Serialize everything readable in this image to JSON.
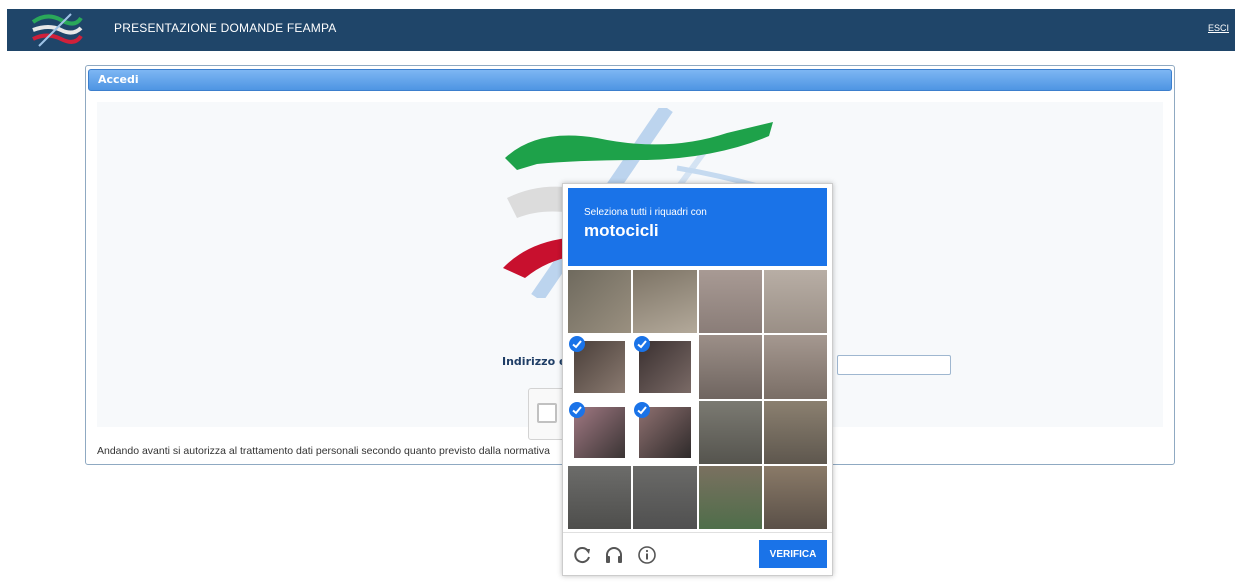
{
  "header": {
    "title": "PRESENTAZIONE DOMANDE FEAMPA",
    "exit_label": "ESCI"
  },
  "panel": {
    "title": "Accedi",
    "email_label": "Indirizzo ema",
    "email_value": "",
    "privacy_text": "Andando avanti si autorizza al trattamento dati personali secondo quanto previsto dalla normativa"
  },
  "recaptcha": {
    "instruction": "Seleziona tutti i riquadri con",
    "target": "motocicli",
    "verify_label": "VERIFICA",
    "tiles": [
      {
        "selected": false
      },
      {
        "selected": false
      },
      {
        "selected": false
      },
      {
        "selected": false
      },
      {
        "selected": true
      },
      {
        "selected": true
      },
      {
        "selected": false
      },
      {
        "selected": false
      },
      {
        "selected": true
      },
      {
        "selected": true
      },
      {
        "selected": false
      },
      {
        "selected": false
      },
      {
        "selected": false
      },
      {
        "selected": false
      },
      {
        "selected": false
      },
      {
        "selected": false
      }
    ],
    "footer_icons": [
      "reload-icon",
      "audio-icon",
      "info-icon"
    ]
  },
  "colors": {
    "header_bg": "#1f4569",
    "panel_header": "#4e95e3",
    "recaptcha_blue": "#1a73e8",
    "flag_green": "#1ea24a",
    "flag_red": "#c8102e"
  }
}
